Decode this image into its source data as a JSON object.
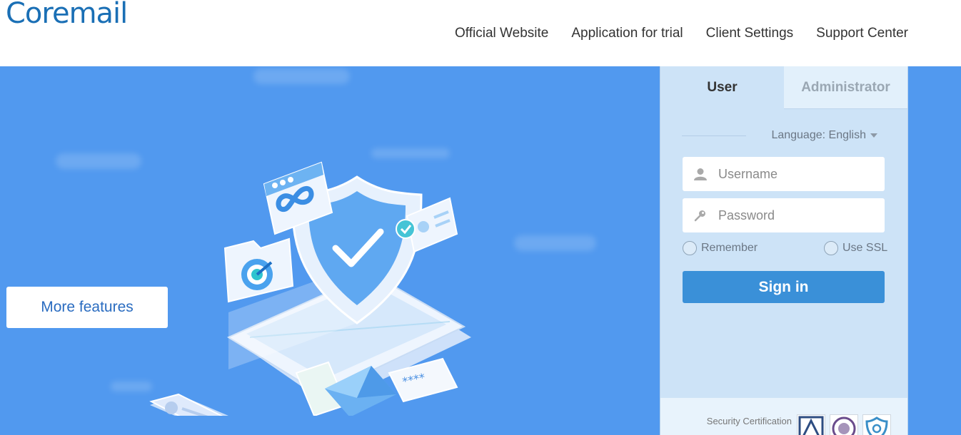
{
  "header": {
    "logo": "Coremail",
    "nav": [
      "Official Website",
      "Application for trial",
      "Client Settings",
      "Support Center"
    ]
  },
  "hero": {
    "more_features_label": "More features"
  },
  "login": {
    "tabs": {
      "user": "User",
      "admin": "Administrator"
    },
    "language_label": "Language: English",
    "username_placeholder": "Username",
    "password_placeholder": "Password",
    "remember_label": "Remember",
    "ssl_label": "Use SSL",
    "signin_label": "Sign in",
    "security_label": "Security Certification"
  },
  "colors": {
    "brand": "#1a6fb5",
    "hero_bg": "#5199ef",
    "panel_bg": "#cde3f7",
    "signin_bg": "#3a90d8"
  },
  "icons": [
    "user-icon",
    "key-icon",
    "shield-check-icon",
    "mail-icon",
    "target-icon",
    "link-icon",
    "id-card-icon"
  ]
}
